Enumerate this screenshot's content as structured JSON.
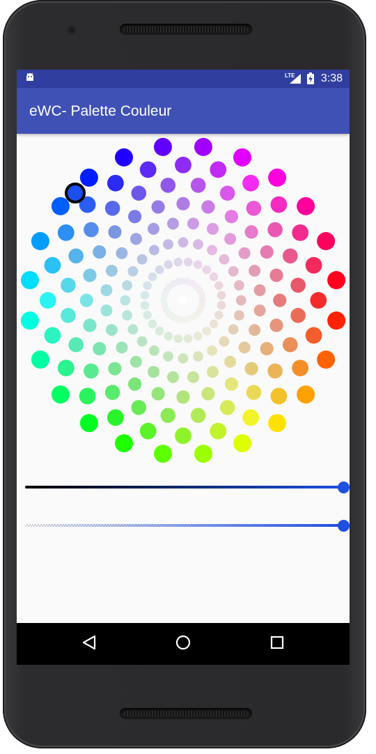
{
  "status_bar": {
    "network": "LTE",
    "time": "3:38",
    "icons": [
      "android-notification-icon",
      "lte-signal-icon",
      "battery-charging-icon"
    ]
  },
  "app_bar": {
    "title": "eWC- Palette Couleur"
  },
  "color_wheel": {
    "rings": 8,
    "dots_per_ring": 24,
    "center_color": "#ffffff",
    "selected_color": "#1a4ff0",
    "selection_border": "#000000"
  },
  "sliders": {
    "brightness": {
      "value": 1.0,
      "start_color": "#000000",
      "end_color": "#1e4fe0"
    },
    "alpha": {
      "value": 1.0,
      "start_color": "transparent",
      "end_color": "#1e4fe0"
    }
  },
  "navigation": [
    "back-icon",
    "home-icon",
    "recents-icon"
  ],
  "colors": {
    "status_bar": "#303f9f",
    "app_bar": "#3f51b5",
    "accent": "#1e4fe0"
  }
}
